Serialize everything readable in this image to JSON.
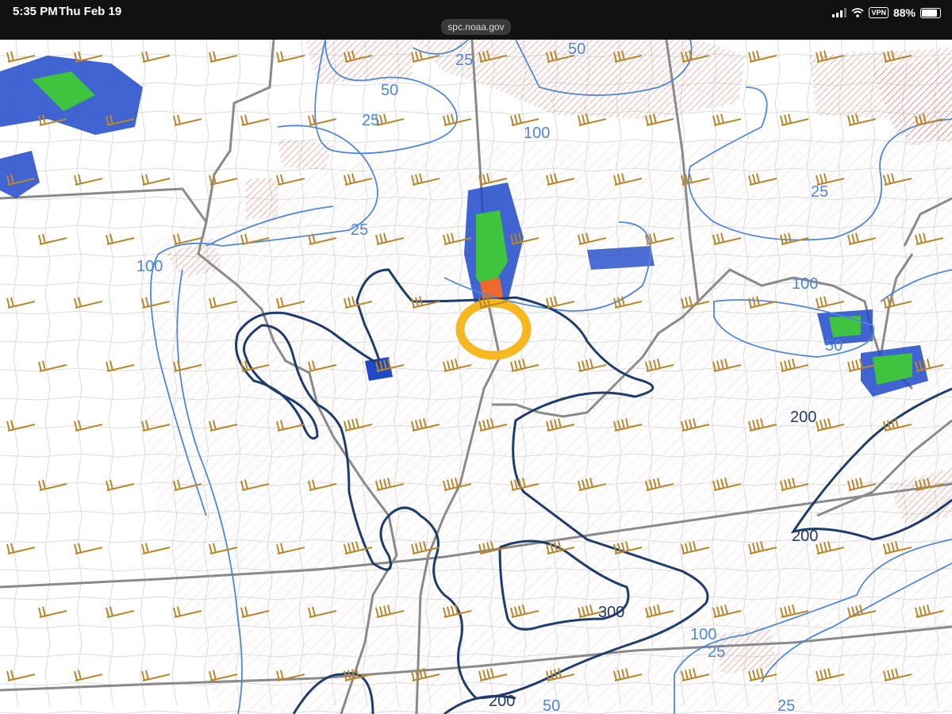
{
  "status_bar": {
    "time": "5:35 PM",
    "date": "Thu Feb 19",
    "url": "spc.noaa.gov",
    "vpn": "VPN",
    "battery": "88%",
    "battery_level": 0.88
  },
  "map": {
    "annotation_color": "#f5b820",
    "light_contour_color": "#4f87d8",
    "dark_contour_color": "#1e3c6e",
    "barb_color": "#b8862b",
    "hatch_color": "#d9534f",
    "border_color": "#8a8a8a",
    "light_labels": {
      "l50_top": "50",
      "l25_top": "25",
      "l50_a": "50",
      "l25_a": "25",
      "l100_a": "100",
      "l25_b": "25",
      "l25_c": "25",
      "l100_b": "100",
      "l100_c": "100",
      "l50_c": "50",
      "l100_d": "100",
      "l25_d": "25",
      "l25_e": "25",
      "l50_bottom": "50"
    },
    "dark_labels": {
      "d200_a": "200",
      "d200_b": "200",
      "d300": "300",
      "d200_c": "200"
    }
  }
}
